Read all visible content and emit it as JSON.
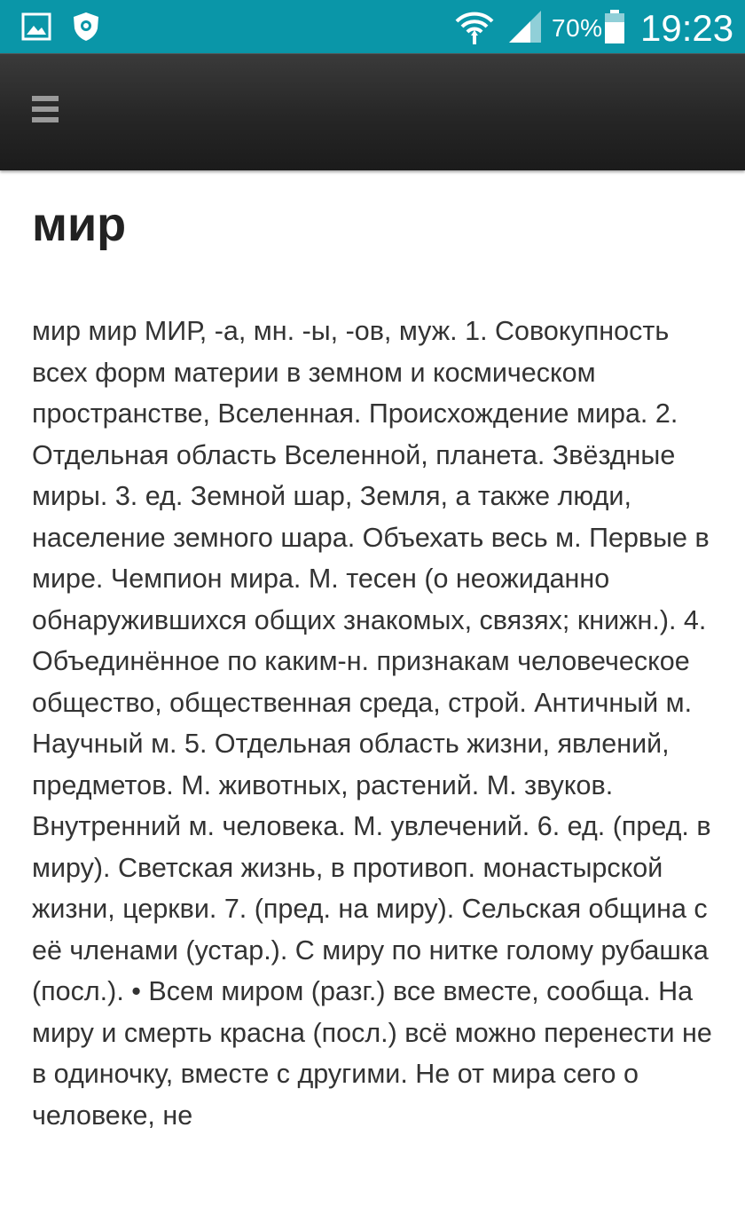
{
  "status_bar": {
    "battery_percent": "70%",
    "time": "19:23",
    "icons": [
      "gallery-icon",
      "shield-icon",
      "wifi-icon",
      "signal-icon",
      "battery-icon"
    ]
  },
  "app_bar": {
    "menu_icon": "hamburger-menu-icon"
  },
  "article": {
    "word": "мир",
    "definition": "мир мир МИР, -а, мн. -ы, -ов, муж. 1. Совокупность всех форм материи в земном и космическом пространстве, Вселенная. Происхождение мира. 2. Отдельная область Вселенной, планета. Звёздные миры. 3. ед. Земной шар, Земля, а также люди, население земного шара. Объехать весь м. Первые в мире. Чемпион мира. М. тесен (о неожиданно обнаружившихся общих знакомых, связях; книжн.). 4. Объединённое по каким-н. признакам человеческое общество, общественная среда, строй. Античный м. Научный м. 5. Отдельная область жизни, явлений, предметов. М. животных, растений. М. звуков. Внутренний м. человека. М. увлечений. 6. ед. (пред. в миру). Светская жизнь, в противоп. монастырской жизни, церкви. 7. (пред. на миру). Сельская община с её членами (устар.). С миру по нитке голому рубашка (посл.). • Всем миром (разг.) все вместе, сообща. На миру и смерть красна (посл.) всё можно перенести не в одиночку, вместе с другими. Не от мира сего о человеке, не"
  },
  "colors": {
    "status_bar": "#0a96a8",
    "app_bar": "#262626",
    "text": "#333333",
    "title": "#222222"
  }
}
